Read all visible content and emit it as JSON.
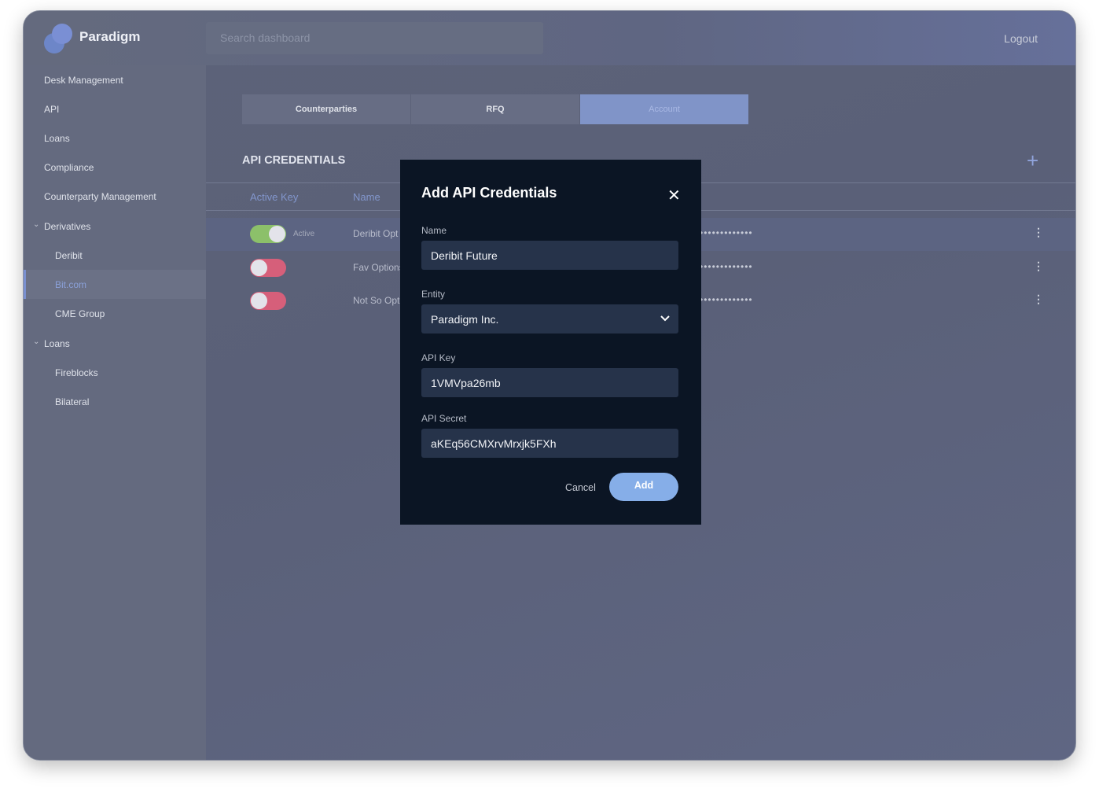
{
  "header": {
    "brand": "Paradigm",
    "search_placeholder": "Search dashboard",
    "logout": "Logout"
  },
  "sidebar": {
    "items": [
      {
        "label": "Desk Management"
      },
      {
        "label": "API"
      },
      {
        "label": "Loans"
      },
      {
        "label": "Compliance"
      },
      {
        "label": "Counterparty Management"
      },
      {
        "label": "Derivatives"
      },
      {
        "label": "Deribit"
      },
      {
        "label": "Bit.com"
      },
      {
        "label": "CME Group"
      },
      {
        "label": "Loans"
      },
      {
        "label": "Fireblocks"
      },
      {
        "label": "Bilateral"
      }
    ]
  },
  "tabs": [
    {
      "label": "Counterparties"
    },
    {
      "label": "RFQ"
    },
    {
      "label": "Account"
    }
  ],
  "section": {
    "title": "API CREDENTIALS"
  },
  "table": {
    "headers": [
      "Active Key",
      "Name"
    ],
    "rows": [
      {
        "active": true,
        "status": "Active",
        "name": "Deribit Opt",
        "key": "•••••••••••••"
      },
      {
        "active": false,
        "status": "",
        "name": "Fav Options",
        "key": "•••••••••••••"
      },
      {
        "active": false,
        "status": "",
        "name": "Not So Opt",
        "key": "•••••••••••••"
      }
    ]
  },
  "modal": {
    "title": "Add API Credentials",
    "name_label": "Name",
    "name_value": "Deribit Future",
    "entity_label": "Entity",
    "entity_value": "Paradigm Inc.",
    "key_label": "API Key",
    "key_value": "1VMVpa26mb",
    "secret_label": "API Secret",
    "secret_value": "aKEq56CMXrvMrxjk5FXh",
    "cancel": "Cancel",
    "add": "Add"
  },
  "colors": {
    "accent": "#86aee8",
    "toggle_on": "#8cc06a",
    "toggle_off": "#d65f7a",
    "modal_bg": "#0b1524"
  }
}
